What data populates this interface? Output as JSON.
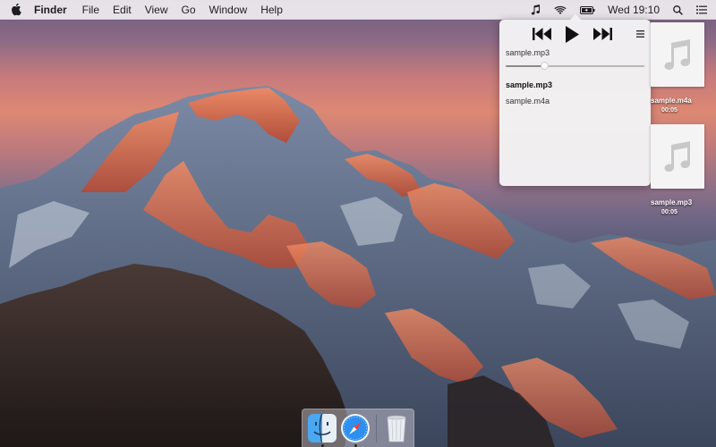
{
  "menubar": {
    "app_name": "Finder",
    "menus": [
      "File",
      "Edit",
      "View",
      "Go",
      "Window",
      "Help"
    ],
    "clock": "Wed 19:10",
    "status_icons": [
      "music-note-icon",
      "wifi-icon",
      "battery-icon",
      "search-icon",
      "list-icon"
    ]
  },
  "player": {
    "now_playing": "sample.mp3",
    "progress": 0.28,
    "playlist": [
      {
        "name": "sample.mp3",
        "active": true
      },
      {
        "name": "sample.m4a",
        "active": false
      }
    ],
    "controls": [
      "previous-icon",
      "play-icon",
      "next-icon"
    ]
  },
  "desktop_files": [
    {
      "name": "sample.m4a",
      "duration": "00:05"
    },
    {
      "name": "sample.mp3",
      "duration": "00:05"
    }
  ],
  "dock": {
    "apps": [
      "Finder",
      "Safari",
      "Trash"
    ]
  },
  "colors": {
    "menubar_bg": "#f0ecf0",
    "popover_bg": "#f2f1f3",
    "accent_dark": "#1d1d1f"
  }
}
